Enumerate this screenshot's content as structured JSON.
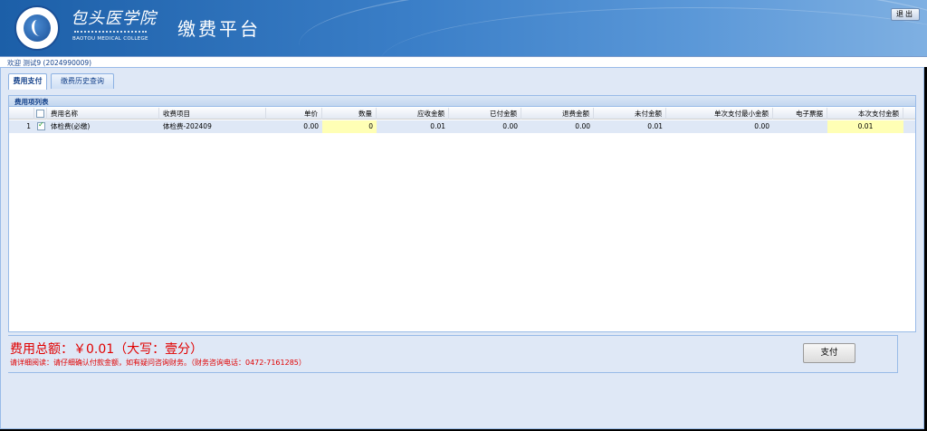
{
  "header": {
    "school_name_cn": "包头医学院",
    "school_name_en": "BAOTOU MEDICAL COLLEGE",
    "app_title": "缴费平台",
    "logout_label": "退出"
  },
  "welcome": "欢迎 测试9 (2024990009)",
  "tabs": [
    {
      "label": "费用支付",
      "active": true
    },
    {
      "label": "缴费历史查询",
      "active": false
    }
  ],
  "panel": {
    "title": "费用项列表",
    "columns": [
      "费用名称",
      "收费项目",
      "单价",
      "数量",
      "应收金额",
      "已付金额",
      "退费金额",
      "未付金额",
      "单次支付最小金额",
      "电子票据",
      "本次支付金额"
    ],
    "rows": [
      {
        "index": "1",
        "checked": true,
        "fee_name": "体检费(必缴)",
        "fee_item": "体检费-202409",
        "unit_price": "0.00",
        "quantity": "0",
        "receivable": "0.01",
        "paid": "0.00",
        "refunded": "0.00",
        "unpaid": "0.01",
        "min_payment": "0.00",
        "e_invoice": "",
        "current_payment": "0.01"
      }
    ]
  },
  "summary": {
    "total_text": "费用总额：￥0.01（大写：壹分）",
    "notice": "请详细阅读：请仔细确认付款金额，如有疑问咨询财务。（财务咨询电话：0472-7161285）",
    "pay_label": "支付"
  },
  "colors": {
    "header_blue": "#3b7fc8",
    "grid_highlight": "#ffffb5",
    "total_red": "#e00000"
  }
}
